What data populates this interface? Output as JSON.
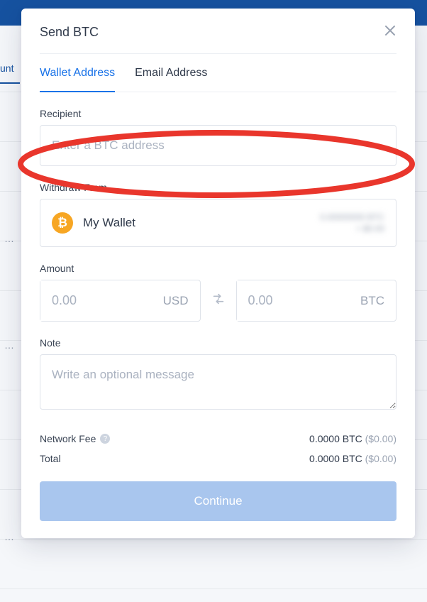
{
  "bg": {
    "tab_fragment": "unt"
  },
  "modal": {
    "title": "Send BTC",
    "tabs": {
      "wallet": "Wallet Address",
      "email": "Email Address"
    },
    "recipient": {
      "label": "Recipient",
      "placeholder": "Enter a BTC address"
    },
    "withdraw": {
      "label": "Withdraw From",
      "wallet_name": "My Wallet",
      "icon_glyph": "₿"
    },
    "amount": {
      "label": "Amount",
      "usd_placeholder": "0.00",
      "usd_label": "USD",
      "btc_placeholder": "0.00",
      "btc_label": "BTC"
    },
    "note": {
      "label": "Note",
      "placeholder": "Write an optional message"
    },
    "fees": {
      "network_label": "Network Fee",
      "network_btc": "0.0000 BTC",
      "network_usd": "($0.00)",
      "total_label": "Total",
      "total_btc": "0.0000 BTC",
      "total_usd": "($0.00)"
    },
    "continue_label": "Continue"
  }
}
